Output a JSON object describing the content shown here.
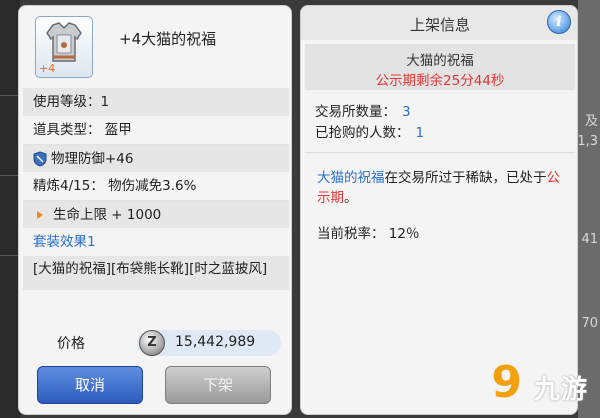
{
  "background": {
    "right_fragments": [
      "及",
      "1,3",
      "41",
      "70"
    ]
  },
  "item": {
    "name": "+4大猫的祝福",
    "icon": "armor-chestplate-icon",
    "refine_badge": "+4"
  },
  "stats": {
    "level": "使用等级：1",
    "type": "道具类型：  盔甲",
    "defense": "物理防御+46",
    "refine": "精炼4/15：  物伤减免3.6%",
    "bonus": "生命上限 + 1000",
    "set_title": "套装效果1",
    "set_body": "[大猫的祝福][布袋熊长靴][时之蓝披风]"
  },
  "price": {
    "label": "价格",
    "currency_icon": "zeny-coin-icon",
    "currency_glyph": "Z",
    "value": "15,442,989"
  },
  "buttons": {
    "cancel": "取消",
    "sell": "下架"
  },
  "listing": {
    "title": "上架信息",
    "info_glyph": "i",
    "item_name": "大猫的祝福",
    "timer": "公示期剩余25分44秒",
    "trade_qty_label": "交易所数量：",
    "trade_qty": "3",
    "grabbed_label": "已抢购的人数：",
    "grabbed": "1",
    "msg_item": "大猫的祝福",
    "msg_mid": "在交易所过于稀缺，已处于",
    "msg_period": "公示期",
    "msg_end": "。",
    "tax": "当前税率：  12％"
  },
  "watermark": {
    "nine": "9",
    "text": "九游"
  },
  "colors": {
    "accent_blue": "#2a6fc9",
    "alert_red": "#e23636",
    "cancel_button": "#2c5bbd",
    "disabled_button": "#9a9a9a"
  }
}
